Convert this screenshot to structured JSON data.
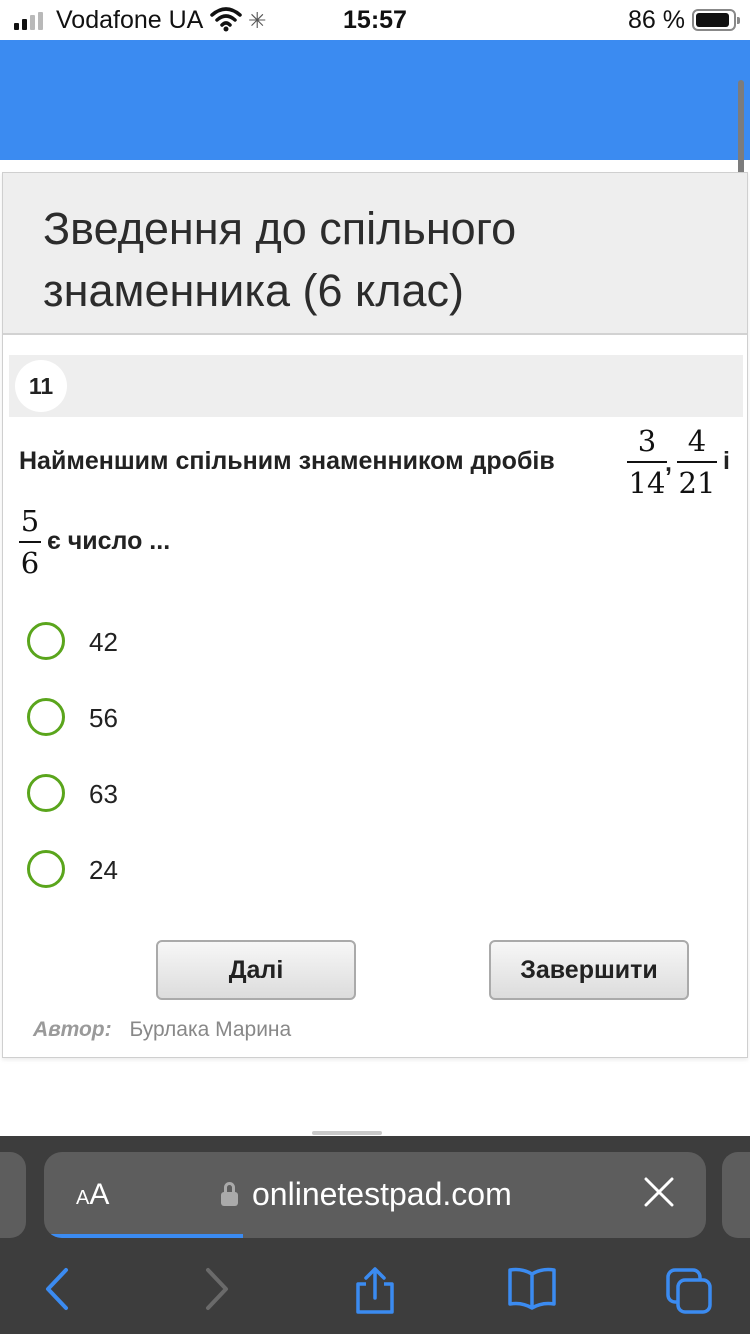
{
  "status_bar": {
    "carrier": "Vodafone UA",
    "time": "15:57",
    "battery": "86 %",
    "battery_level": 0.86
  },
  "test": {
    "title": "Зведення до спільного знаменника (6 клас)",
    "question_number": "11",
    "question": {
      "text_before": "Найменшим спільним знаменником дробів",
      "fraction1": {
        "num": "3",
        "den": "14"
      },
      "comma": ",",
      "fraction2": {
        "num": "4",
        "den": "21"
      },
      "conj": "і",
      "fraction3": {
        "num": "5",
        "den": "6"
      },
      "text_after": "є число ..."
    },
    "options": [
      {
        "label": "42",
        "selected": false
      },
      {
        "label": "56",
        "selected": false
      },
      {
        "label": "63",
        "selected": false
      },
      {
        "label": "24",
        "selected": false
      }
    ],
    "next_label": "Далі",
    "finish_label": "Завершити",
    "author_label": "Автор:",
    "author_name": "Бурлака Марина"
  },
  "browser": {
    "aa_small": "A",
    "aa_big": "A",
    "url": "onlinetestpad.com",
    "load_progress": 0.3
  },
  "colors": {
    "header_blue": "#3b8bf1",
    "radio_green": "#5aa51c",
    "toolbar_bg": "#3d3d3d",
    "toolbar_icon": "#3b8bf1"
  },
  "icons": {
    "wifi": "wifi-icon",
    "activity": "activity-spinner-icon",
    "lock": "lock-icon",
    "close": "close-icon",
    "back": "chevron-left-icon",
    "forward": "chevron-right-icon",
    "share": "share-icon",
    "bookmarks": "book-icon",
    "tabs": "tabs-icon"
  }
}
